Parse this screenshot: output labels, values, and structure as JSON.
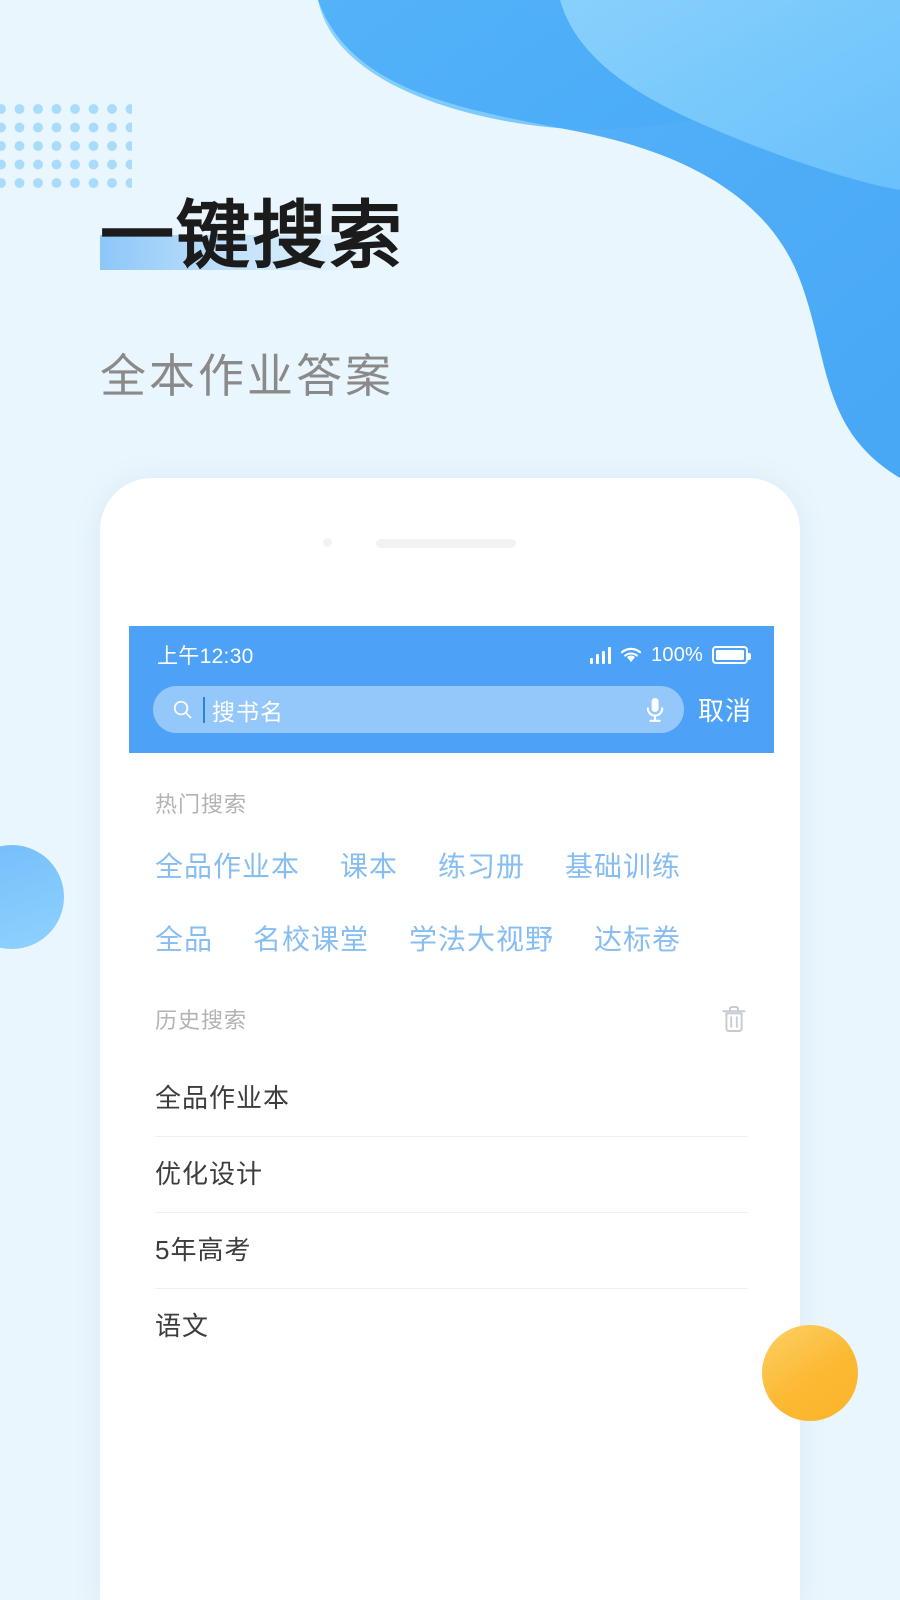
{
  "hero": {
    "title": "一键搜索",
    "subtitle": "全本作业答案"
  },
  "phone": {
    "status_bar": {
      "time": "上午12:30",
      "battery_percent": "100%",
      "signal_icon": "signal-bars-icon",
      "wifi_icon": "wifi-icon",
      "battery_icon": "battery-full-icon"
    },
    "search": {
      "search_icon": "search-icon",
      "placeholder": "搜书名",
      "value": "",
      "mic_icon": "microphone-icon",
      "cancel_label": "取消"
    },
    "hot_search": {
      "label": "热门搜索",
      "rows": [
        [
          "全品作业本",
          "课本",
          "练习册",
          "基础训练"
        ],
        [
          "全品",
          "名校课堂",
          "学法大视野",
          "达标卷"
        ]
      ]
    },
    "history": {
      "label": "历史搜索",
      "clear_icon": "trash-icon",
      "items": [
        "全品作业本",
        "优化设计",
        "5年高考",
        "语文"
      ]
    }
  },
  "theme": {
    "page_bg": "#eaf6fd",
    "blob_light": "#7fcbfc",
    "blob_dark": "#4aacf7",
    "accent_blue": "#4da2f7",
    "tag_blue": "#86bdf3",
    "dot_blue": "#a9dcfb",
    "circle_yellow": "#fcb933",
    "title_color": "#1b1b1b",
    "subtitle_color": "#8a8a8a"
  }
}
